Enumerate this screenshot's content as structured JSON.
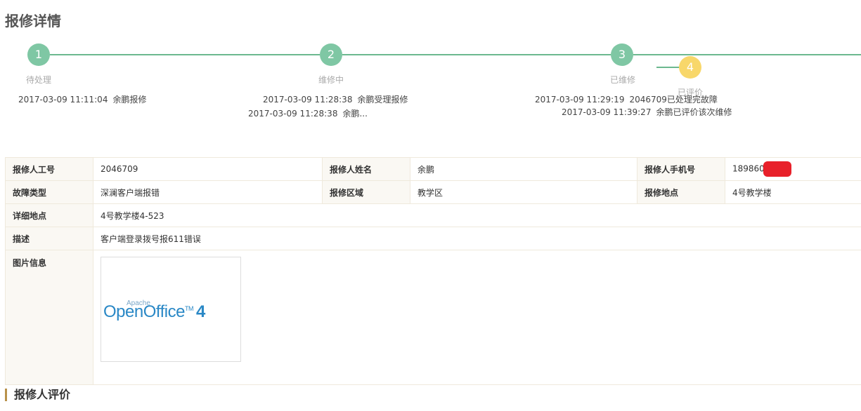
{
  "page": {
    "title": "报修详情"
  },
  "colors": {
    "step_done": "#7fc7a4",
    "step_current": "#f8d76a",
    "line": "#6cb88f",
    "section_accent": "#b8914a"
  },
  "steps": [
    {
      "number": "1",
      "label": "待处理"
    },
    {
      "number": "2",
      "label": "维修中"
    },
    {
      "number": "3",
      "label": "已维修"
    },
    {
      "number": "4",
      "label": "已评价"
    }
  ],
  "logs": {
    "step1": [
      {
        "time": "2017-03-09 11:11:04",
        "text": "余鹏报修"
      }
    ],
    "step2": [
      {
        "time": "2017-03-09 11:28:38",
        "text": "余鹏受理报修"
      },
      {
        "time": "2017-03-09 11:28:38",
        "text": "余鹏..."
      }
    ],
    "step3": [
      {
        "time": "2017-03-09 11:29:19",
        "text": "2046709已处理完故障"
      },
      {
        "time": "2017-03-09 11:39:27",
        "text": "余鹏已评价该次维修"
      }
    ]
  },
  "info": {
    "reporter_id_label": "报修人工号",
    "reporter_id": "2046709",
    "reporter_name_label": "报修人姓名",
    "reporter_name": "余鹏",
    "reporter_phone_label": "报修人手机号",
    "reporter_phone": "189860",
    "fault_type_label": "故障类型",
    "fault_type": "深澜客户端报错",
    "area_label": "报修区域",
    "area": "教学区",
    "location_label": "报修地点",
    "location": "4号教学楼",
    "detail_location_label": "详细地点",
    "detail_location": "4号教学楼4-523",
    "description_label": "描述",
    "description": "客户端登录拨号报611错误",
    "images_label": "图片信息"
  },
  "thumbnail": {
    "apache": "Apache",
    "name": "OpenOffice",
    "tm": "TM",
    "version": "4"
  },
  "sections": {
    "evaluation_title": "报修人评价"
  }
}
